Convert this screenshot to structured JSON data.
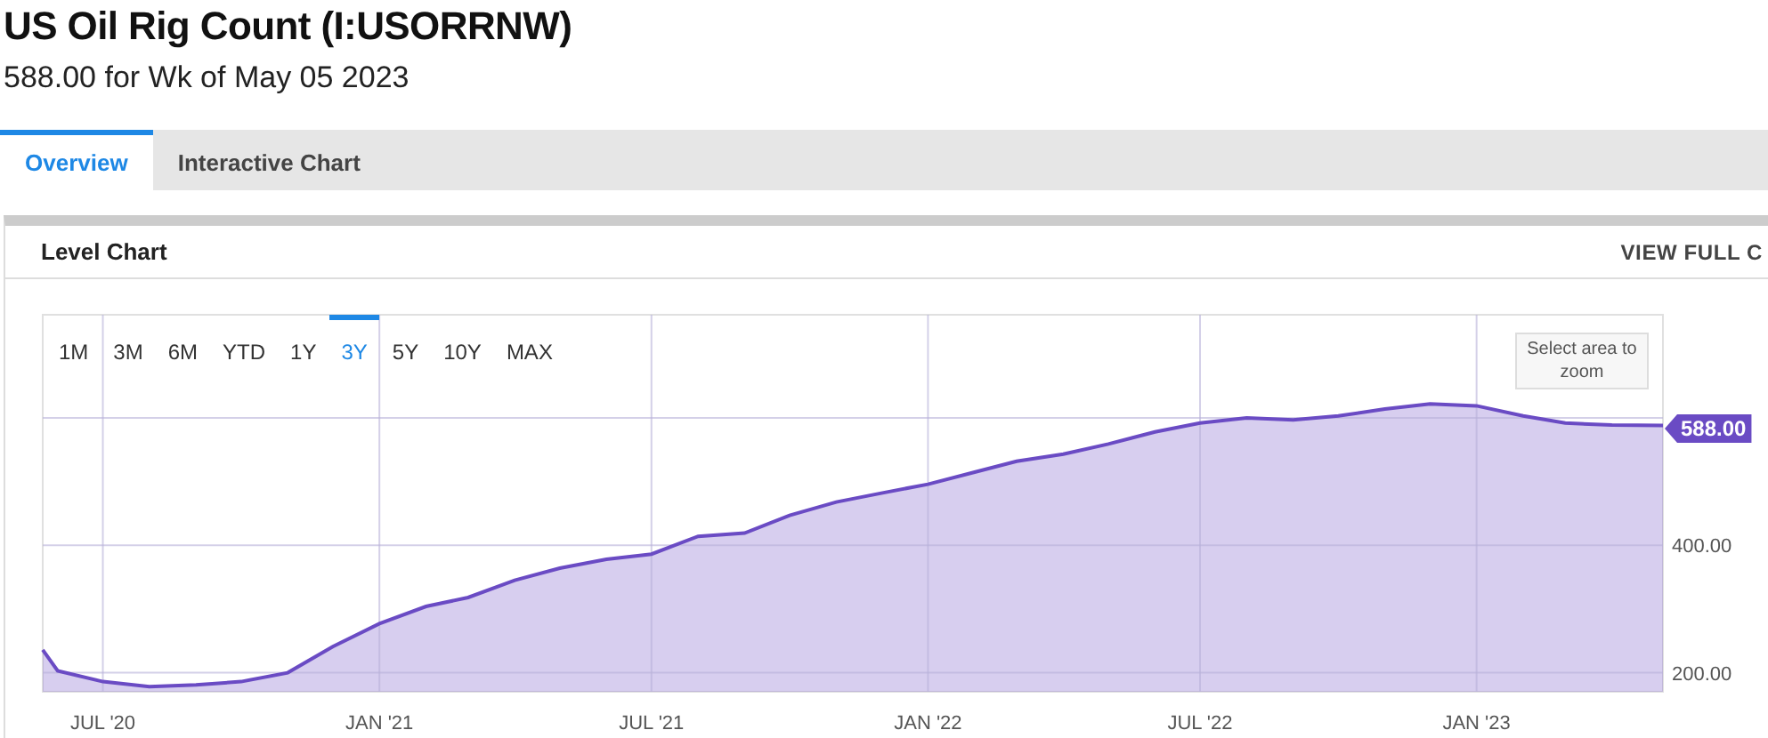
{
  "header": {
    "title": "US Oil Rig Count (I:USORRNW)",
    "subtitle": "588.00 for Wk of May 05 2023"
  },
  "tabs": [
    {
      "label": "Overview",
      "selected": true
    },
    {
      "label": "Interactive Chart",
      "selected": false
    }
  ],
  "panel": {
    "title": "Level Chart",
    "link": "VIEW FULL C",
    "ranges": [
      {
        "label": "1M",
        "selected": false
      },
      {
        "label": "3M",
        "selected": false
      },
      {
        "label": "6M",
        "selected": false
      },
      {
        "label": "YTD",
        "selected": false
      },
      {
        "label": "1Y",
        "selected": false
      },
      {
        "label": "3Y",
        "selected": true
      },
      {
        "label": "5Y",
        "selected": false
      },
      {
        "label": "10Y",
        "selected": false
      },
      {
        "label": "MAX",
        "selected": false
      }
    ],
    "zoom_hint": "Select area to zoom",
    "last_value_label": "588.00",
    "chart_data": {
      "type": "area",
      "x": [
        "2020-05-22",
        "2020-06-01",
        "2020-07-01",
        "2020-08-01",
        "2020-09-01",
        "2020-10-01",
        "2020-11-01",
        "2020-12-01",
        "2021-01-01",
        "2021-02-01",
        "2021-03-01",
        "2021-04-01",
        "2021-05-01",
        "2021-06-01",
        "2021-07-01",
        "2021-08-01",
        "2021-09-01",
        "2021-10-01",
        "2021-11-01",
        "2021-12-01",
        "2022-01-01",
        "2022-02-01",
        "2022-03-01",
        "2022-04-01",
        "2022-05-01",
        "2022-06-01",
        "2022-07-01",
        "2022-08-01",
        "2022-09-01",
        "2022-10-01",
        "2022-11-01",
        "2022-12-01",
        "2023-01-01",
        "2023-02-01",
        "2023-03-01",
        "2023-04-01",
        "2023-05-05"
      ],
      "series": [
        {
          "color": "#6a4bc4",
          "values": [
            236,
            203,
            186,
            178,
            181,
            186,
            200,
            241,
            277,
            304,
            318,
            345,
            364,
            378,
            386,
            414,
            419,
            447,
            468,
            482,
            496,
            515,
            532,
            543,
            559,
            578,
            592,
            600,
            597,
            603,
            614,
            622,
            619,
            603,
            592,
            589,
            588
          ]
        }
      ],
      "xlim": [
        "2020-05-22",
        "2023-05-05"
      ],
      "ylim": [
        170,
        762
      ],
      "yticks": [
        {
          "value": 200,
          "label": "200.00"
        },
        {
          "value": 400,
          "label": "400.00"
        }
      ],
      "grid": true,
      "xticks": [
        {
          "value": "2020-07-01",
          "label": "JUL '20"
        },
        {
          "value": "2021-01-01",
          "label": "JAN '21"
        },
        {
          "value": "2021-07-01",
          "label": "JUL '21"
        },
        {
          "value": "2022-01-01",
          "label": "JAN '22"
        },
        {
          "value": "2022-07-01",
          "label": "JUL '22"
        },
        {
          "value": "2023-01-01",
          "label": "JAN '23"
        }
      ]
    }
  }
}
